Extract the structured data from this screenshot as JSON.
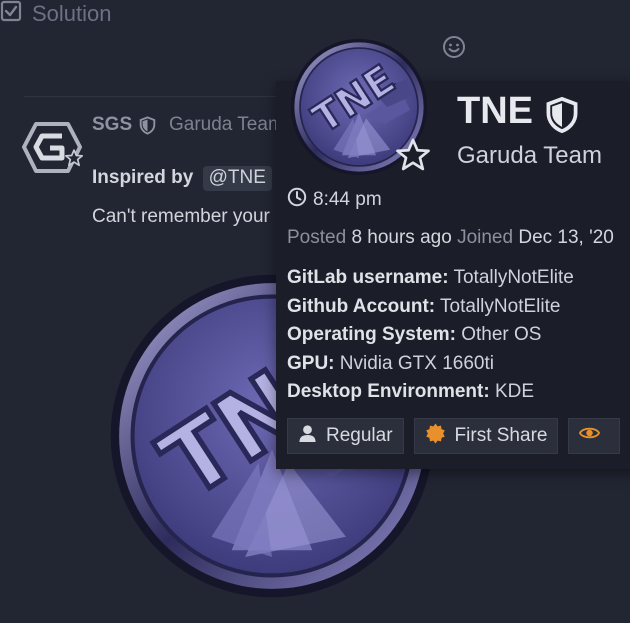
{
  "topbar": {
    "solution_label": "Solution",
    "icons": [
      "smile-icon",
      "checkbox-icon"
    ]
  },
  "post": {
    "username": "SGS",
    "group": "Garuda Team",
    "quote_label": "Inspired by",
    "mention": "@TNE",
    "body": "Can't remember your"
  },
  "card": {
    "name": "TNE",
    "title": "Garuda Team",
    "local_time": "8:44 pm",
    "posted_label": "Posted",
    "posted_value": "8 hours ago",
    "joined_label": "Joined",
    "joined_value": "Dec 13, '20",
    "fields": [
      {
        "name": "GitLab username:",
        "value": "TotallyNotElite"
      },
      {
        "name": "Github Account:",
        "value": "TotallyNotElite"
      },
      {
        "name": "Operating System:",
        "value": "Other OS"
      },
      {
        "name": "GPU:",
        "value": "Nvidia GTX 1660ti"
      },
      {
        "name": "Desktop Environment:",
        "value": "KDE"
      }
    ],
    "badges": [
      {
        "label": "Regular",
        "icon": "user-icon"
      },
      {
        "label": "First Share",
        "icon": "certificate-icon"
      },
      {
        "label": "",
        "icon": "eye-icon"
      }
    ]
  },
  "colors": {
    "background": "#222633",
    "card_background": "#1b1e28",
    "accent_purple": "#6b68b0",
    "badge_orange": "#e8902c"
  }
}
